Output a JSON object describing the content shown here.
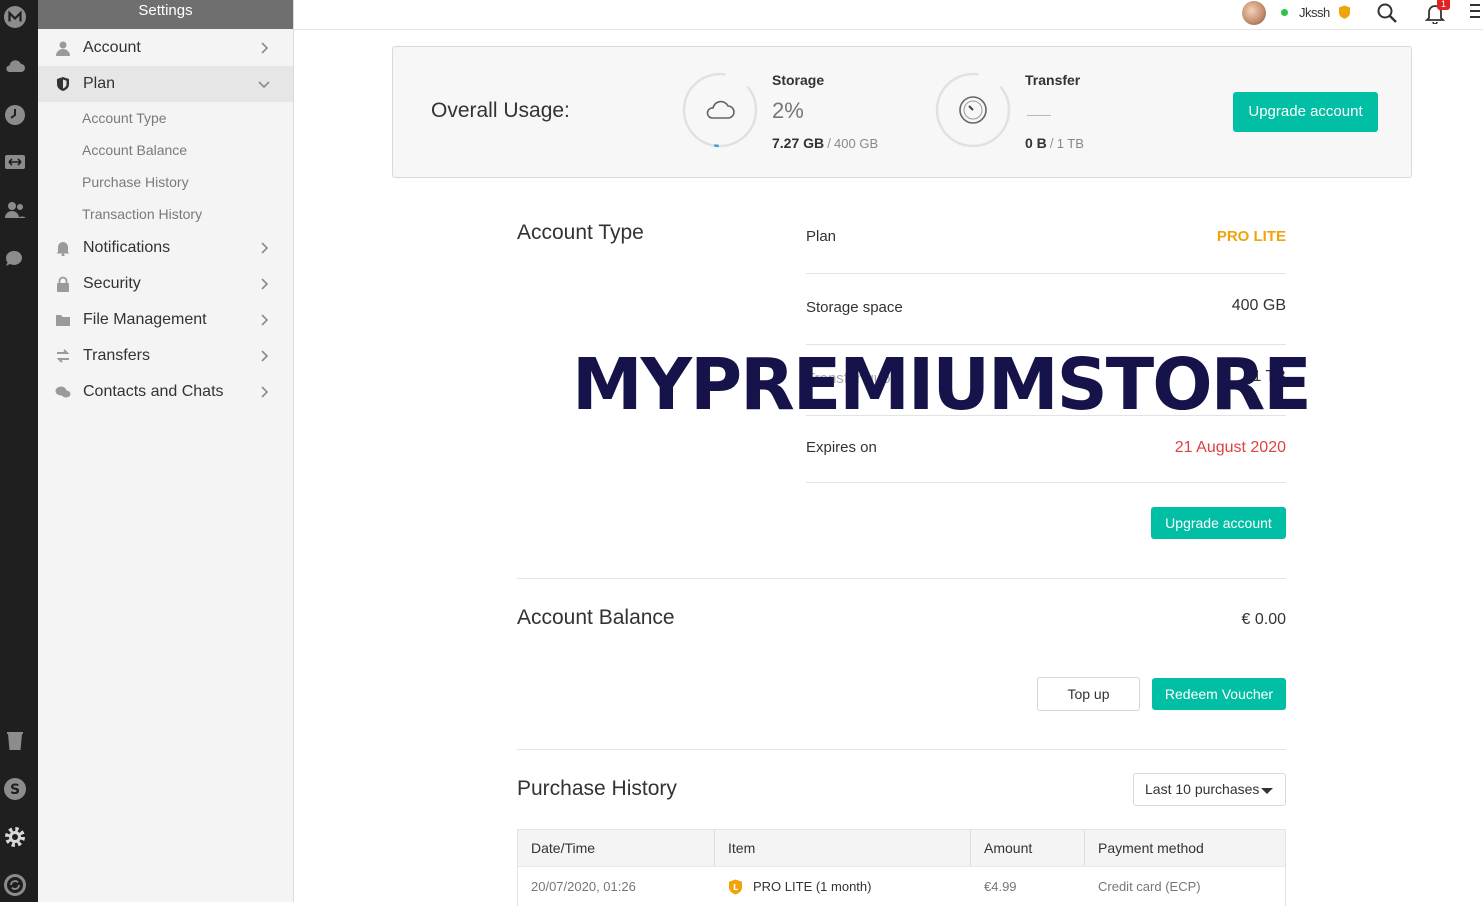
{
  "app": {
    "name": "MEGA"
  },
  "rail": {
    "icons": [
      "mega-logo-icon",
      "cloud-drive-icon",
      "recents-clock-icon",
      "transfers-arrows-icon",
      "contacts-icon",
      "chat-icon",
      "rubbish-bin-icon",
      "achievements-icon",
      "settings-gear-icon",
      "sync-icon"
    ]
  },
  "sidebar": {
    "header": "Settings",
    "items": [
      {
        "label": "Account",
        "icon": "user-icon"
      },
      {
        "label": "Plan",
        "icon": "shield-icon"
      },
      {
        "label": "Notifications",
        "icon": "bell-icon"
      },
      {
        "label": "Security",
        "icon": "lock-icon"
      },
      {
        "label": "File Management",
        "icon": "folder-icon"
      },
      {
        "label": "Transfers",
        "icon": "transfer-arrows-icon"
      },
      {
        "label": "Contacts and Chats",
        "icon": "chat-bubbles-icon"
      }
    ],
    "plan_subitems": [
      "Account Type",
      "Account Balance",
      "Purchase History",
      "Transaction History"
    ]
  },
  "topbar": {
    "username": "Jkssh",
    "notification_count": "1"
  },
  "usage": {
    "title": "Overall Usage:",
    "storage": {
      "label": "Storage",
      "percent": "2%",
      "percent_value": 0.02,
      "used": "7.27 GB",
      "separator": "/",
      "total": "400 GB"
    },
    "transfer": {
      "label": "Transfer",
      "used": "0 B",
      "separator": "/",
      "total": "1 TB"
    },
    "upgrade_button": "Upgrade account"
  },
  "account_type": {
    "title": "Account Type",
    "rows": [
      {
        "label": "Plan",
        "value": "PRO LITE"
      },
      {
        "label": "Storage space",
        "value": "400 GB"
      },
      {
        "label": "Transfer quota",
        "value": "1 TB"
      },
      {
        "label": "Expires on",
        "value": "21 August 2020"
      }
    ],
    "upgrade_button": "Upgrade account"
  },
  "watermark": "MYPREMIUMSTORE",
  "account_balance": {
    "title": "Account Balance",
    "value": "€ 0.00",
    "topup_button": "Top up",
    "redeem_button": "Redeem Voucher"
  },
  "purchase_history": {
    "title": "Purchase History",
    "filter": "Last 10 purchases",
    "columns": [
      "Date/Time",
      "Item",
      "Amount",
      "Payment method"
    ],
    "rows": [
      {
        "date": "20/07/2020, 01:26",
        "item": "PRO LITE (1 month)",
        "amount": "€4.99",
        "method": "Credit card (ECP)"
      }
    ]
  },
  "colors": {
    "accent": "#00bfa5",
    "pro_lite": "#f0a30a",
    "expiry": "#e04040",
    "rail": "#1f1f1f",
    "watermark": "#16134a"
  }
}
